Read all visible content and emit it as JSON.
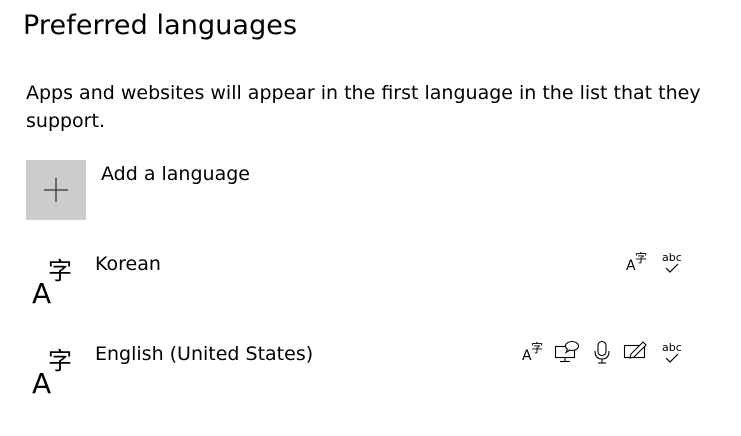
{
  "page": {
    "title": "Preferred languages",
    "description": "Apps and websites will appear in the first language in the list that they support."
  },
  "add_language": {
    "label": "Add a language",
    "icon": "plus-icon"
  },
  "languages": [
    {
      "name": "Korean",
      "icon": "language-icon",
      "features": [
        "display-language-icon",
        "spelling-icon"
      ]
    },
    {
      "name": "English (United States)",
      "icon": "language-icon",
      "features": [
        "display-language-icon",
        "text-to-speech-icon",
        "speech-recognition-icon",
        "handwriting-icon",
        "spelling-icon"
      ]
    }
  ],
  "feature_glyphs": {
    "display": "字",
    "spelling": "abc"
  },
  "colors": {
    "tile_bg": "#cccccc",
    "text": "#000000",
    "background": "#ffffff"
  }
}
